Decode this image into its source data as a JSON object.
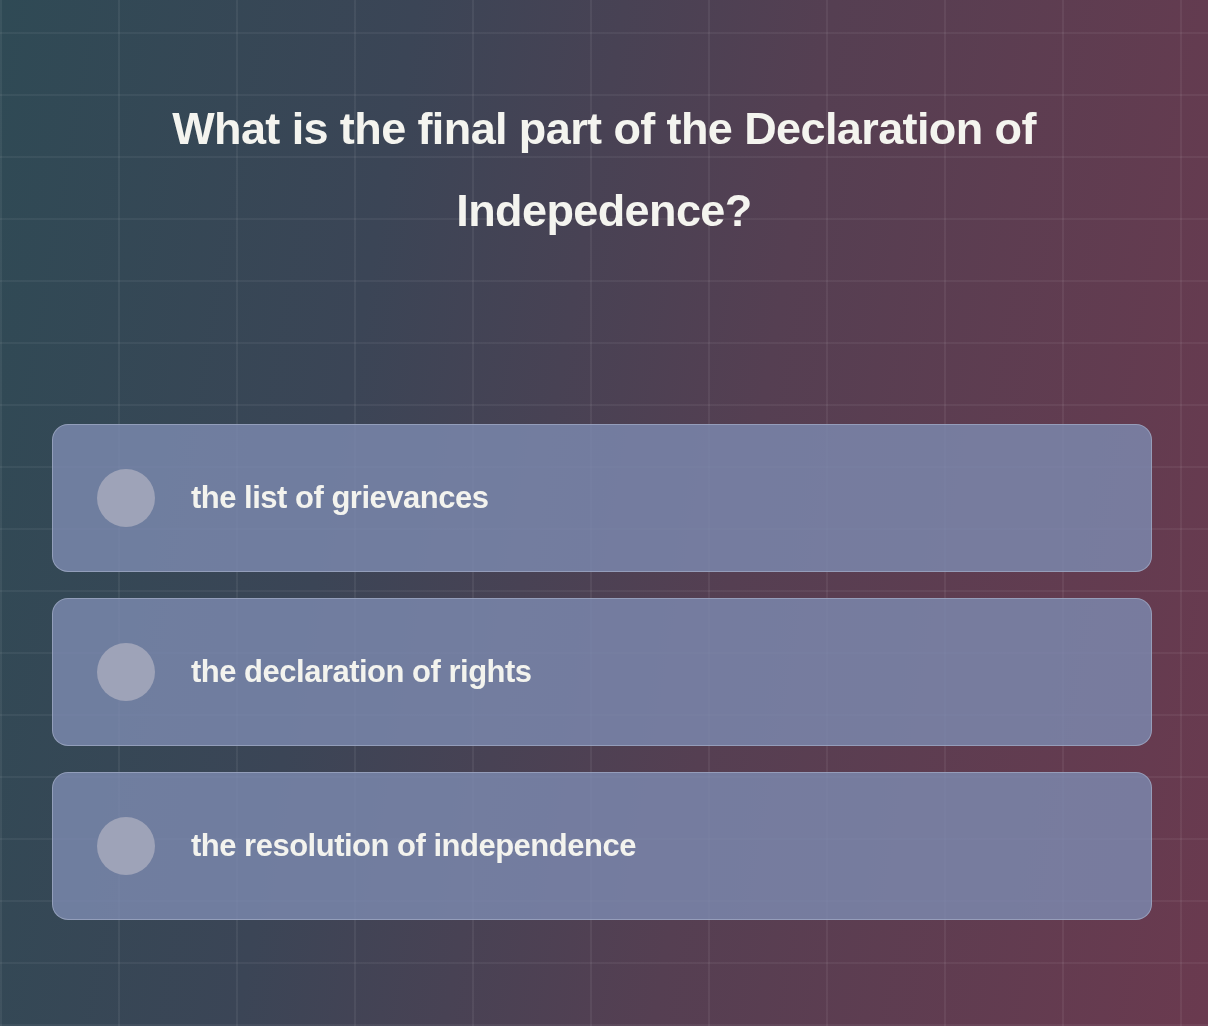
{
  "question": "What is the final part of the Declaration of Indepedence?",
  "options": [
    {
      "label": "the list of grievances",
      "selected": false
    },
    {
      "label": "the declaration of rights",
      "selected": false
    },
    {
      "label": "the resolution of independence",
      "selected": false
    }
  ]
}
